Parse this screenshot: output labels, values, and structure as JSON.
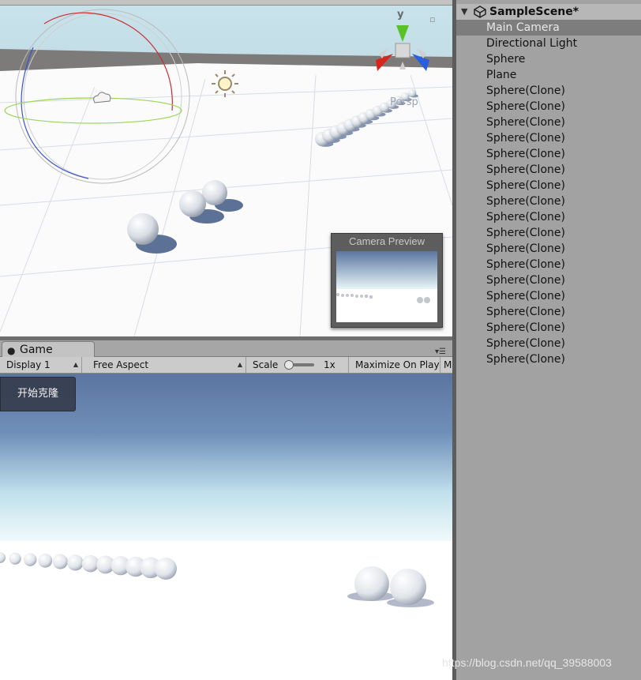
{
  "scene_view": {
    "gizmo_axis_label": "y",
    "projection_label": "Persp",
    "camera_preview_title": "Camera Preview"
  },
  "game_panel": {
    "tab_label": "Game",
    "display": "Display 1",
    "aspect": "Free Aspect",
    "scale_label": "Scale",
    "scale_value": "1x",
    "scale_fraction": 0.0,
    "maximize": "Maximize On Play",
    "truncated_next": "Mu",
    "clone_button_label": "开始克隆"
  },
  "hierarchy": {
    "scene_name": "SampleScene*",
    "items": [
      {
        "label": "Main Camera",
        "selected": true
      },
      {
        "label": "Directional Light"
      },
      {
        "label": "Sphere"
      },
      {
        "label": "Plane"
      },
      {
        "label": "Sphere(Clone)"
      },
      {
        "label": "Sphere(Clone)"
      },
      {
        "label": "Sphere(Clone)"
      },
      {
        "label": "Sphere(Clone)"
      },
      {
        "label": "Sphere(Clone)"
      },
      {
        "label": "Sphere(Clone)"
      },
      {
        "label": "Sphere(Clone)"
      },
      {
        "label": "Sphere(Clone)"
      },
      {
        "label": "Sphere(Clone)"
      },
      {
        "label": "Sphere(Clone)"
      },
      {
        "label": "Sphere(Clone)"
      },
      {
        "label": "Sphere(Clone)"
      },
      {
        "label": "Sphere(Clone)"
      },
      {
        "label": "Sphere(Clone)"
      },
      {
        "label": "Sphere(Clone)"
      },
      {
        "label": "Sphere(Clone)"
      },
      {
        "label": "Sphere(Clone)"
      },
      {
        "label": "Sphere(Clone)"
      }
    ]
  },
  "watermark": "https://blog.csdn.net/qq_39588003",
  "colors": {
    "sky_top": "#5a75a0",
    "sky_horizon": "#e8f6f8",
    "ground": "#ffffff",
    "selection": "#7d7d7d",
    "gizmo_x": "#d9261c",
    "gizmo_y": "#5ac229",
    "gizmo_z": "#2a5fdc"
  }
}
